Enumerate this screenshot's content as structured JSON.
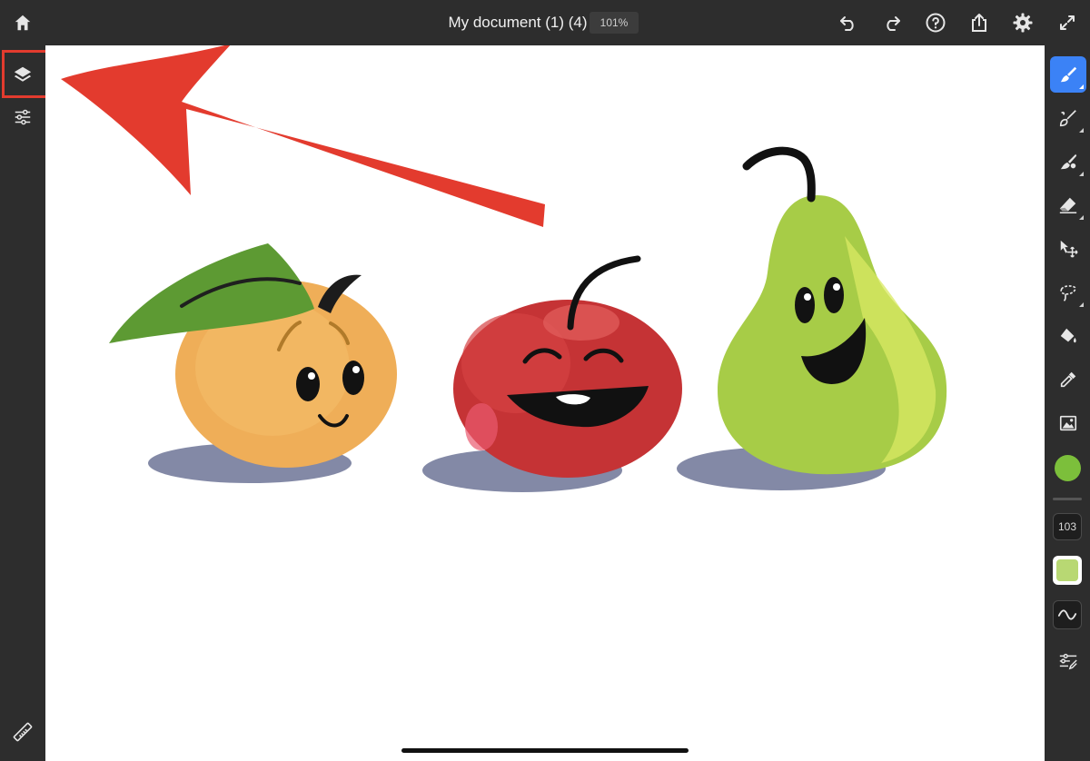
{
  "header": {
    "document_title": "My document (1) (4)",
    "zoom": "101%"
  },
  "icons": {
    "home": "home-icon",
    "undo": "undo-icon",
    "redo": "redo-icon",
    "help": "help-icon",
    "share": "share-icon",
    "settings": "gear-icon",
    "fullscreen": "fullscreen-icon",
    "layers": "layers-icon",
    "adjustments": "sliders-icon",
    "ruler": "ruler-icon"
  },
  "right_toolbar": {
    "tools": [
      "pixel-brush",
      "live-brush",
      "vector-brush",
      "eraser",
      "move",
      "lasso",
      "fill",
      "eyedropper",
      "image"
    ],
    "brush_size": "103",
    "current_color": "#7cbf3b",
    "swatch_color": "#b8d873"
  },
  "colors": {
    "highlight": "#e33b2e",
    "active_tool": "#3b82f6",
    "chrome": "#2d2d2d"
  }
}
